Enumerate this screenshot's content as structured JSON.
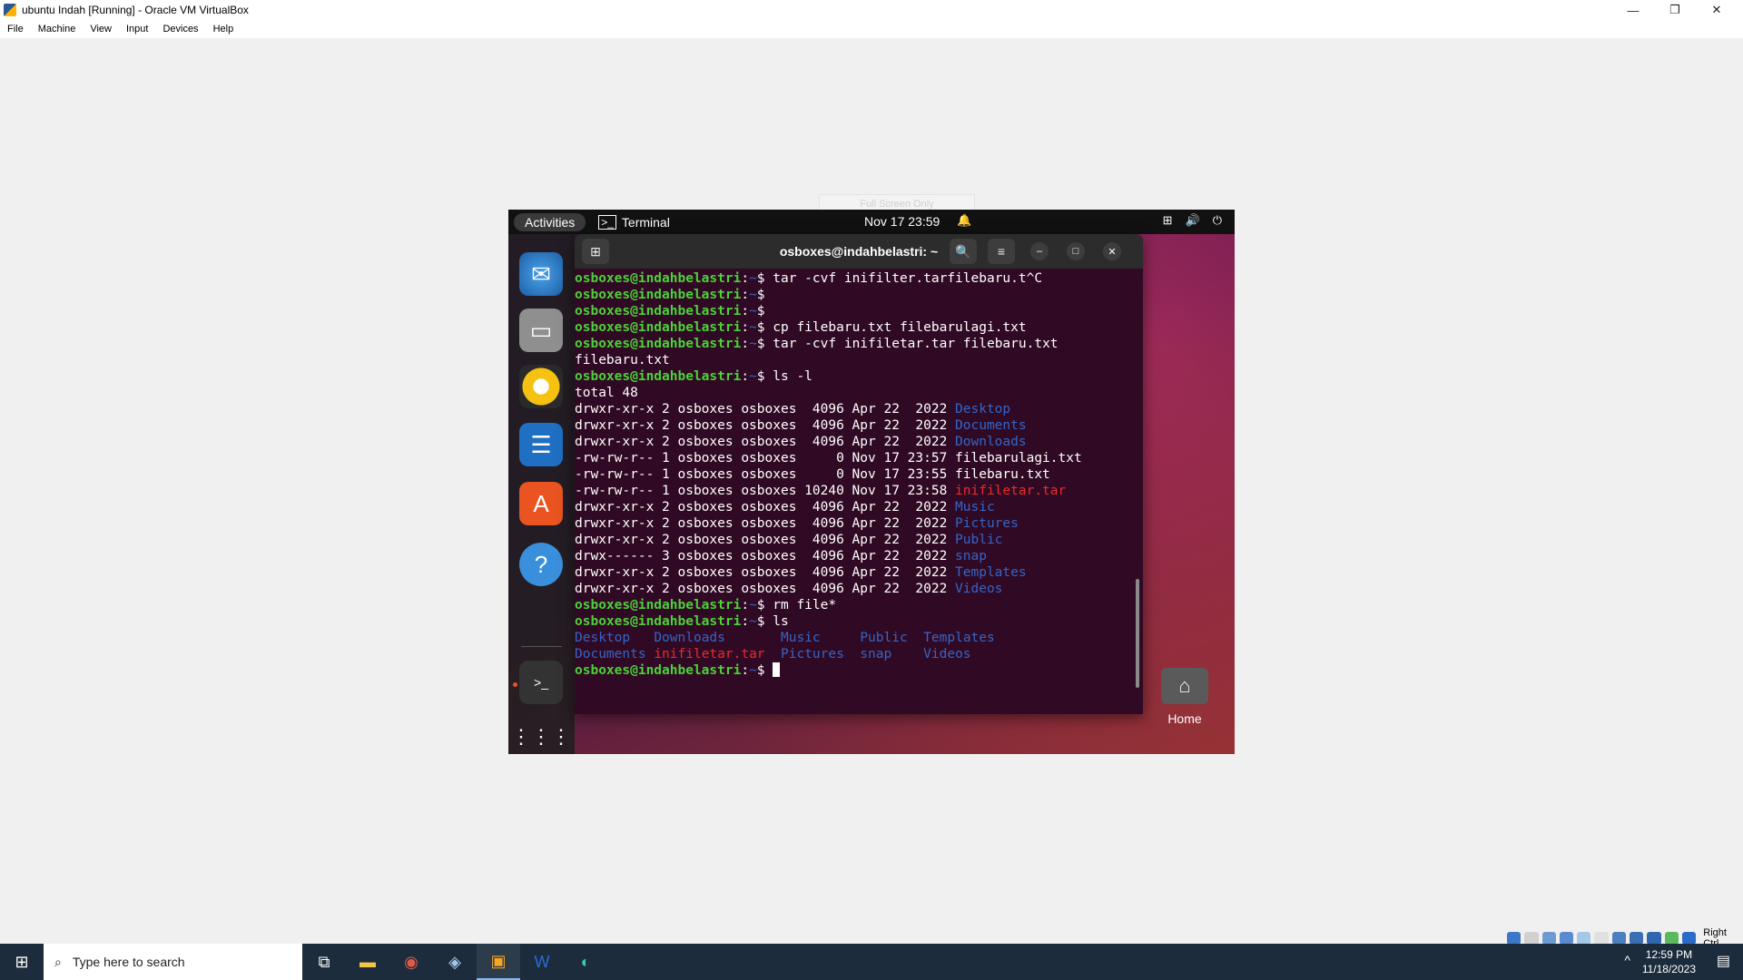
{
  "host": {
    "title": "ubuntu Indah [Running] - Oracle VM VirtualBox",
    "menu": [
      "File",
      "Machine",
      "View",
      "Input",
      "Devices",
      "Help"
    ],
    "scale_hint": "Full Screen Only",
    "status_right": "Right Ctrl"
  },
  "gnome": {
    "activities": "Activities",
    "app_name": "Terminal",
    "clock": "Nov 17  23:59",
    "home_label": "Home",
    "dock": [
      "mail-icon",
      "files-icon",
      "music-icon",
      "writer-icon",
      "store-icon",
      "help-icon",
      "terminal-icon",
      "apps-grid-icon"
    ]
  },
  "terminal": {
    "title": "osboxes@indahbelastri: ~",
    "prompt": "osboxes@indahbelastri",
    "lines": [
      {
        "type": "cmd",
        "text": "tar -cvf inifilter.tarfilebaru.t^C"
      },
      {
        "type": "cmd",
        "text": ""
      },
      {
        "type": "cmd",
        "text": ""
      },
      {
        "type": "cmd",
        "text": "cp filebaru.txt filebarulagi.txt"
      },
      {
        "type": "cmd",
        "text": "tar -cvf inifiletar.tar filebaru.txt"
      },
      {
        "type": "out",
        "text": "filebaru.txt"
      },
      {
        "type": "cmd",
        "text": "ls -l"
      },
      {
        "type": "out",
        "text": "total 48"
      },
      {
        "type": "ls",
        "meta": "drwxr-xr-x 2 osboxes osboxes  4096 Apr 22  2022 ",
        "name": "Desktop",
        "kind": "dir"
      },
      {
        "type": "ls",
        "meta": "drwxr-xr-x 2 osboxes osboxes  4096 Apr 22  2022 ",
        "name": "Documents",
        "kind": "dir"
      },
      {
        "type": "ls",
        "meta": "drwxr-xr-x 2 osboxes osboxes  4096 Apr 22  2022 ",
        "name": "Downloads",
        "kind": "dir"
      },
      {
        "type": "ls",
        "meta": "-rw-rw-r-- 1 osboxes osboxes     0 Nov 17 23:57 ",
        "name": "filebarulagi.txt",
        "kind": "file"
      },
      {
        "type": "ls",
        "meta": "-rw-rw-r-- 1 osboxes osboxes     0 Nov 17 23:55 ",
        "name": "filebaru.txt",
        "kind": "file"
      },
      {
        "type": "ls",
        "meta": "-rw-rw-r-- 1 osboxes osboxes 10240 Nov 17 23:58 ",
        "name": "inifiletar.tar",
        "kind": "arch"
      },
      {
        "type": "ls",
        "meta": "drwxr-xr-x 2 osboxes osboxes  4096 Apr 22  2022 ",
        "name": "Music",
        "kind": "dir"
      },
      {
        "type": "ls",
        "meta": "drwxr-xr-x 2 osboxes osboxes  4096 Apr 22  2022 ",
        "name": "Pictures",
        "kind": "dir"
      },
      {
        "type": "ls",
        "meta": "drwxr-xr-x 2 osboxes osboxes  4096 Apr 22  2022 ",
        "name": "Public",
        "kind": "dir"
      },
      {
        "type": "ls",
        "meta": "drwx------ 3 osboxes osboxes  4096 Apr 22  2022 ",
        "name": "snap",
        "kind": "dir"
      },
      {
        "type": "ls",
        "meta": "drwxr-xr-x 2 osboxes osboxes  4096 Apr 22  2022 ",
        "name": "Templates",
        "kind": "dir"
      },
      {
        "type": "ls",
        "meta": "drwxr-xr-x 2 osboxes osboxes  4096 Apr 22  2022 ",
        "name": "Videos",
        "kind": "dir"
      },
      {
        "type": "cmd",
        "text": "rm file*"
      },
      {
        "type": "cmd",
        "text": "ls"
      },
      {
        "type": "cols",
        "items": [
          {
            "name": "Desktop",
            "kind": "dir",
            "pad": "   "
          },
          {
            "name": "Downloads",
            "kind": "dir",
            "pad": "       "
          },
          {
            "name": "Music",
            "kind": "dir",
            "pad": "     "
          },
          {
            "name": "Public",
            "kind": "dir",
            "pad": "  "
          },
          {
            "name": "Templates",
            "kind": "dir",
            "pad": ""
          }
        ]
      },
      {
        "type": "cols",
        "items": [
          {
            "name": "Documents",
            "kind": "dir",
            "pad": " "
          },
          {
            "name": "inifiletar.tar",
            "kind": "arch",
            "pad": "  "
          },
          {
            "name": "Pictures",
            "kind": "dir",
            "pad": "  "
          },
          {
            "name": "snap",
            "kind": "dir",
            "pad": "    "
          },
          {
            "name": "Videos",
            "kind": "dir",
            "pad": ""
          }
        ]
      },
      {
        "type": "cursor",
        "text": ""
      }
    ]
  },
  "taskbar": {
    "search_placeholder": "Type here to search",
    "time": "12:59 PM",
    "date": "11/18/2023",
    "apps": [
      "task-view-icon",
      "file-explorer-icon",
      "app-icon",
      "virtualbox-icon",
      "vbox-vm-icon",
      "word-icon",
      "edge-icon"
    ]
  },
  "colors": {
    "prompt": "#4cd138",
    "directory": "#3465c8",
    "archive": "#ef2929",
    "terminal_bg": "#300a24"
  }
}
